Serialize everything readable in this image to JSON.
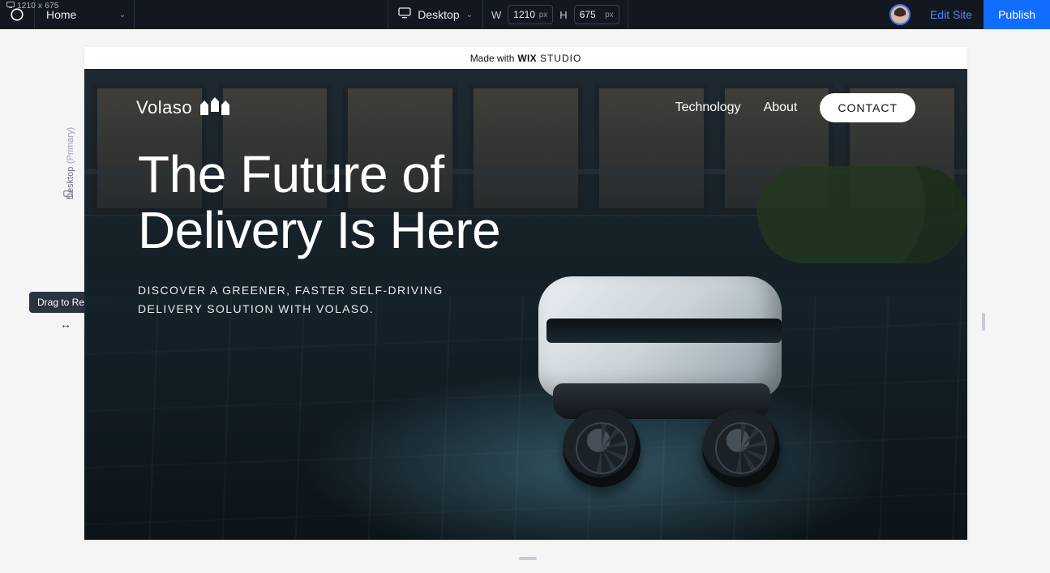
{
  "toolbar": {
    "dimensions_overlay": "1210 x 675",
    "page_name": "Home",
    "device_label": "Desktop",
    "width_label": "W",
    "width_value": "1210",
    "width_unit": "px",
    "height_label": "H",
    "height_value": "675",
    "height_unit": "px",
    "edit_site": "Edit Site",
    "publish": "Publish"
  },
  "side": {
    "breakpoint_primary": "(Primary)",
    "breakpoint_name": "Desktop"
  },
  "tooltip": {
    "resize": "Drag to Resize"
  },
  "preview": {
    "made_with_prefix": "Made with ",
    "made_with_brand1": "WIX",
    "made_with_brand2": "STUDIO",
    "brand": "Volaso",
    "nav": {
      "technology": "Technology",
      "about": "About",
      "contact": "CONTACT"
    },
    "hero_line1": "The Future of",
    "hero_line2": "Delivery Is Here",
    "subtitle": "DISCOVER A GREENER, FASTER SELF-DRIVING DELIVERY SOLUTION WITH VOLASO."
  }
}
